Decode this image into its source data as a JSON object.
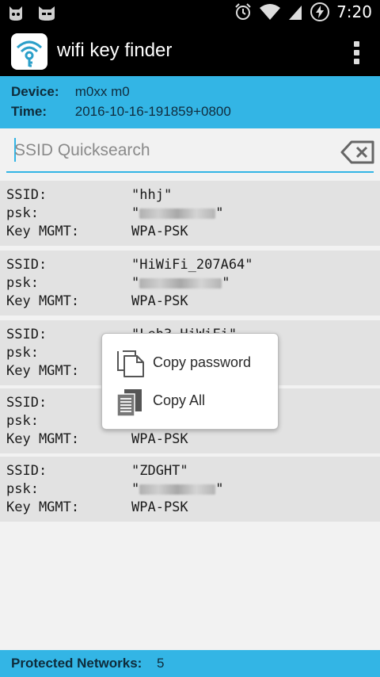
{
  "status_bar": {
    "time": "7:20",
    "left_icons": [
      "ghost-icon",
      "cat-icon"
    ],
    "right_icons": [
      "alarm-icon",
      "wifi-icon",
      "signal-icon",
      "battery-charging-icon"
    ]
  },
  "action_bar": {
    "title": "wifi key finder",
    "logo_icon": "wifi-key-logo-icon",
    "overflow_icon": "overflow-menu-icon"
  },
  "device_info": {
    "device_label": "Device:",
    "device_value": "m0xx m0",
    "time_label": "Time:",
    "time_value": "2016-10-16-191859+0800"
  },
  "search": {
    "placeholder": "SSID Quicksearch",
    "clear_icon": "backspace-clear-icon"
  },
  "networks": [
    {
      "ssid_label": "SSID:",
      "ssid": "\"hhj\"",
      "psk_label": "psk:",
      "psk_open": "\"",
      "psk_close": "\"",
      "key_label": "Key MGMT:",
      "key_mgmt": "WPA-PSK"
    },
    {
      "ssid_label": "SSID:",
      "ssid": "\"HiWiFi_207A64\"",
      "psk_label": "psk:",
      "psk_open": "\"",
      "psk_close": "\"",
      "key_label": "Key MGMT:",
      "key_mgmt": "WPA-PSK"
    },
    {
      "ssid_label": "SSID:",
      "ssid": "\"Leh3_HiWiFi\"",
      "psk_label": "psk:",
      "psk_open": "",
      "psk_close": "",
      "key_label": "Key MGMT:",
      "key_mgmt": ""
    },
    {
      "ssid_label": "SSID:",
      "ssid": "",
      "psk_label": "psk:",
      "psk_open": "",
      "psk_close": "",
      "key_label": "Key MGMT:",
      "key_mgmt": "WPA-PSK"
    },
    {
      "ssid_label": "SSID:",
      "ssid": "\"ZDGHT\"",
      "psk_label": "psk:",
      "psk_open": "\"",
      "psk_close": "\"",
      "key_label": "Key MGMT:",
      "key_mgmt": "WPA-PSK"
    }
  ],
  "popup": {
    "items": [
      {
        "label": "Copy password",
        "icon": "copy-icon"
      },
      {
        "label": "Copy All",
        "icon": "copy-all-icon"
      }
    ]
  },
  "footer": {
    "label": "Protected Networks:",
    "count": "5"
  },
  "colors": {
    "accent": "#33b5e5",
    "card": "#e2e2e2",
    "background": "#f2f2f2"
  }
}
